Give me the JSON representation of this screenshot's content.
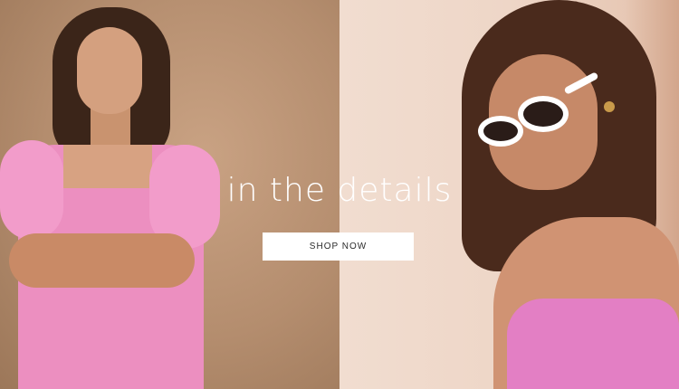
{
  "hero": {
    "headline": "in the details",
    "cta_label": "SHOP NOW"
  },
  "images": {
    "left": "model-pink-eyelet-dress-photo",
    "right": "model-white-sunglasses-pink-top-photo"
  }
}
